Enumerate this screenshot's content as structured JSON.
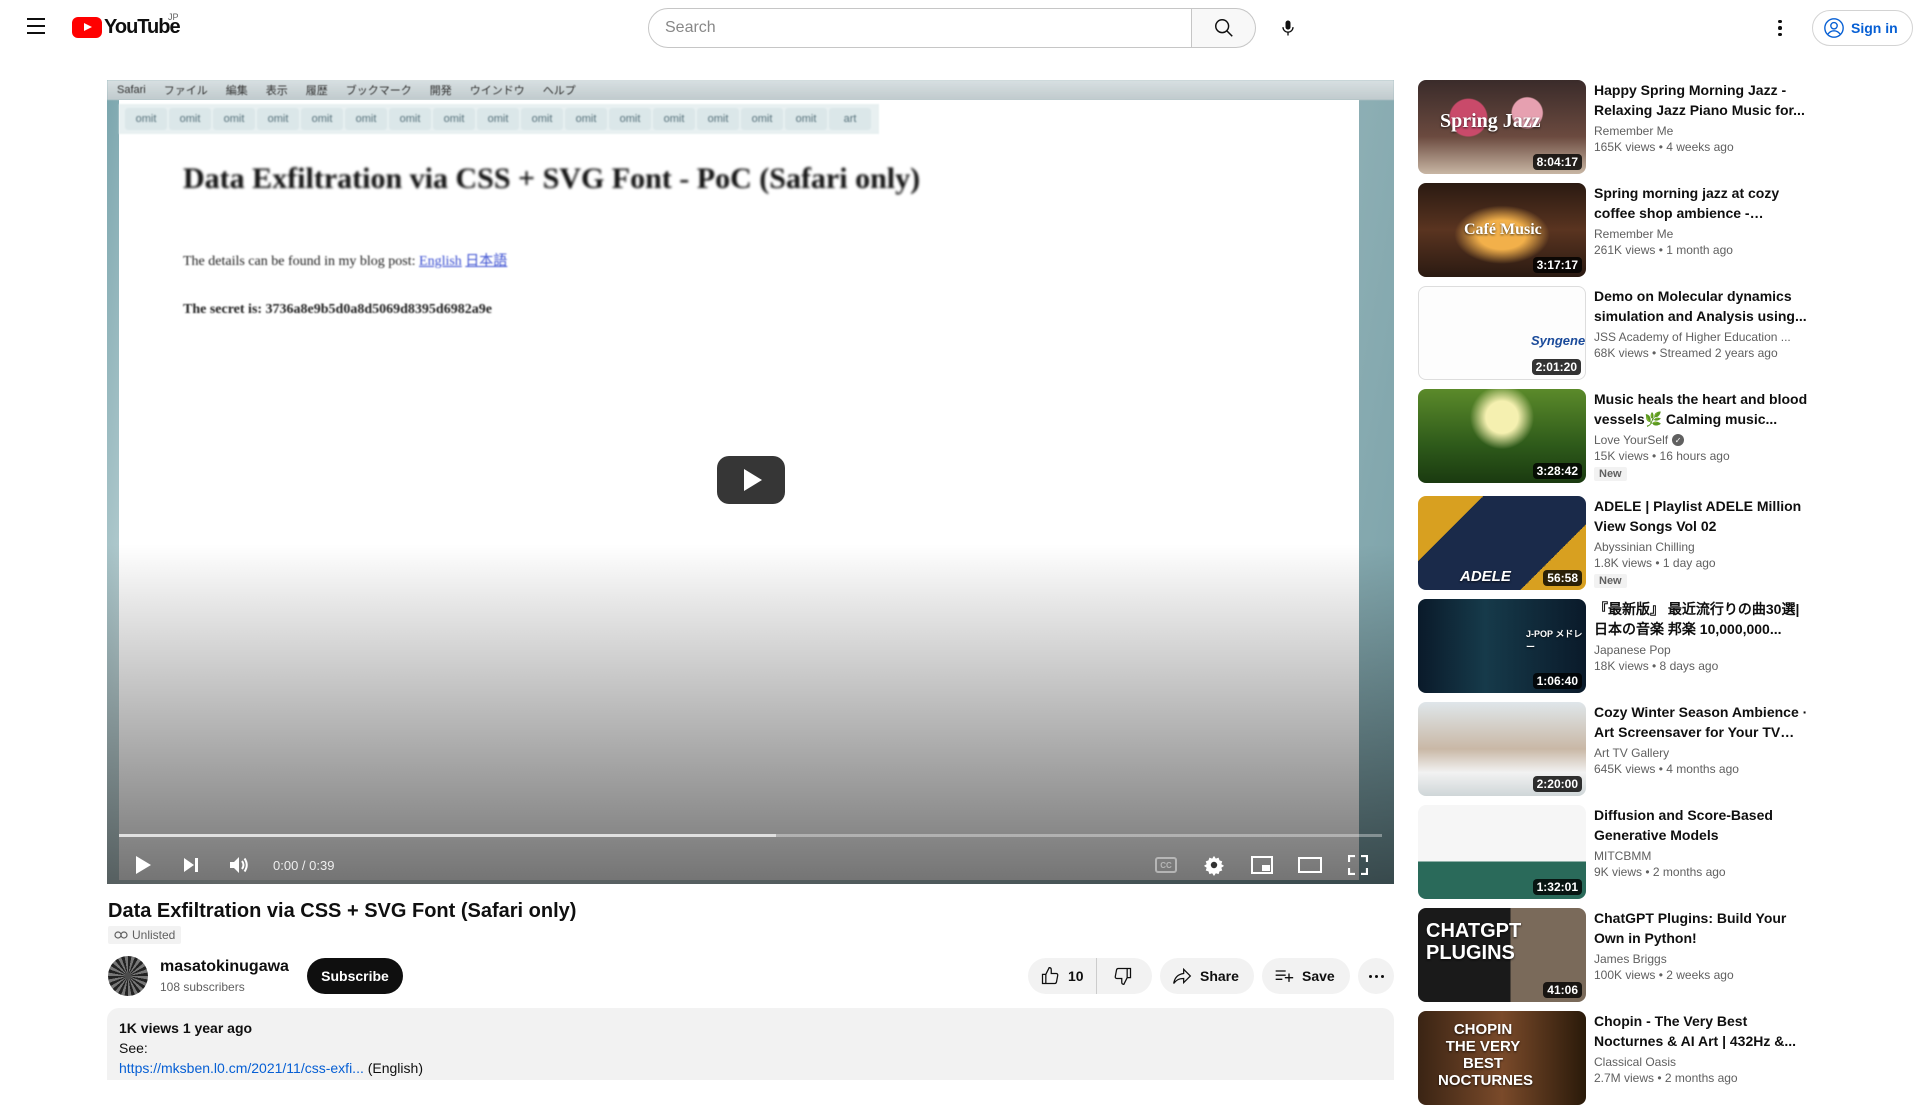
{
  "header": {
    "logo_text": "YouTube",
    "country": "JP",
    "search_placeholder": "Search",
    "signin_label": "Sign in"
  },
  "player": {
    "time": "0:00 / 0:39",
    "buffer_progress": 0.52,
    "mac_menu": [
      "Safari",
      "ファイル",
      "編集",
      "表示",
      "履歴",
      "ブックマーク",
      "開発",
      "ウインドウ",
      "ヘルプ"
    ],
    "tab_labels": [
      "omit",
      "omit",
      "omit",
      "omit",
      "omit",
      "omit",
      "omit",
      "omit",
      "omit",
      "omit",
      "omit",
      "omit",
      "omit",
      "omit",
      "omit",
      "omit",
      "art"
    ],
    "page_heading": "Data Exfiltration via CSS + SVG Font - PoC (Safari only)",
    "page_text_1": "The details can be found in my blog post:",
    "page_link_en": "English",
    "page_link_ja": "日本語",
    "page_text_2": "The secret is: 3736a8e9b5d0a8d5069d8395d6982a9e"
  },
  "video": {
    "title": "Data Exfiltration via CSS + SVG Font (Safari only)",
    "visibility": "Unlisted",
    "channel_name": "masatokinugawa",
    "subscribers": "108 subscribers",
    "subscribe_label": "Subscribe",
    "like_count": "10",
    "share_label": "Share",
    "save_label": "Save",
    "description": {
      "meta": "1K views  1 year ago",
      "see": "See:",
      "link": "https://mksben.l0.cm/2021/11/css-exfi...",
      "link_suffix": " (English)"
    }
  },
  "recommendations": [
    {
      "title": "Happy Spring Morning Jazz - Relaxing Jazz Piano Music for...",
      "channel": "Remember Me",
      "meta": "165K views  •  4 weeks ago",
      "duration": "8:04:17",
      "thumb_text": "Spring Jazz",
      "verified": false,
      "badge": ""
    },
    {
      "title": "Spring morning jazz at cozy coffee shop ambience - Relaxing...",
      "channel": "Remember Me",
      "meta": "261K views  •  1 month ago",
      "duration": "3:17:17",
      "thumb_text": "Café Music",
      "verified": false,
      "badge": ""
    },
    {
      "title": "Demo on Molecular dynamics simulation and Analysis using...",
      "channel": "JSS Academy of Higher Education ...",
      "meta": "68K views  •  Streamed 2 years ago",
      "duration": "2:01:20",
      "thumb_text": "Syngene",
      "verified": false,
      "badge": ""
    },
    {
      "title": "Music heals the heart and blood vessels🌿 Calming music...",
      "channel": "Love YourSelf",
      "meta": "15K views  •  16 hours ago",
      "duration": "3:28:42",
      "thumb_text": "",
      "verified": true,
      "badge": "New"
    },
    {
      "title": "ADELE | Playlist ADELE Million View Songs Vol 02",
      "channel": "Abyssinian Chilling",
      "meta": "1.8K views  •  1 day ago",
      "duration": "56:58",
      "thumb_text": "ADELE",
      "verified": false,
      "badge": "New"
    },
    {
      "title": "『最新版』 最近流行りの曲30選|日本の音楽 邦楽 10,000,000...",
      "channel": "Japanese Pop",
      "meta": "18K views  •  8 days ago",
      "duration": "1:06:40",
      "thumb_text": "J-POP メドレー",
      "verified": false,
      "badge": ""
    },
    {
      "title": "Cozy Winter Season Ambience · Art Screensaver for Your TV —...",
      "channel": "Art TV Gallery",
      "meta": "645K views  •  4 months ago",
      "duration": "2:20:00",
      "thumb_text": "",
      "verified": false,
      "badge": ""
    },
    {
      "title": "Diffusion and Score-Based Generative Models",
      "channel": "MITCBMM",
      "meta": "9K views  •  2 months ago",
      "duration": "1:32:01",
      "thumb_text": "",
      "verified": false,
      "badge": ""
    },
    {
      "title": "ChatGPT Plugins: Build Your Own in Python!",
      "channel": "James Briggs",
      "meta": "100K views  •  2 weeks ago",
      "duration": "41:06",
      "thumb_text": "CHATGPT PLUGINS",
      "verified": false,
      "badge": ""
    },
    {
      "title": "Chopin - The Very Best Nocturnes & AI Art | 432Hz &...",
      "channel": "Classical Oasis",
      "meta": "2.7M views  •  2 months ago",
      "duration": "",
      "thumb_text": "CHOPIN THE VERY BEST NOCTURNES",
      "verified": false,
      "badge": ""
    }
  ],
  "colors": {
    "brand_red": "#ff0000",
    "link_blue": "#065fd4",
    "text_secondary": "#606060"
  }
}
